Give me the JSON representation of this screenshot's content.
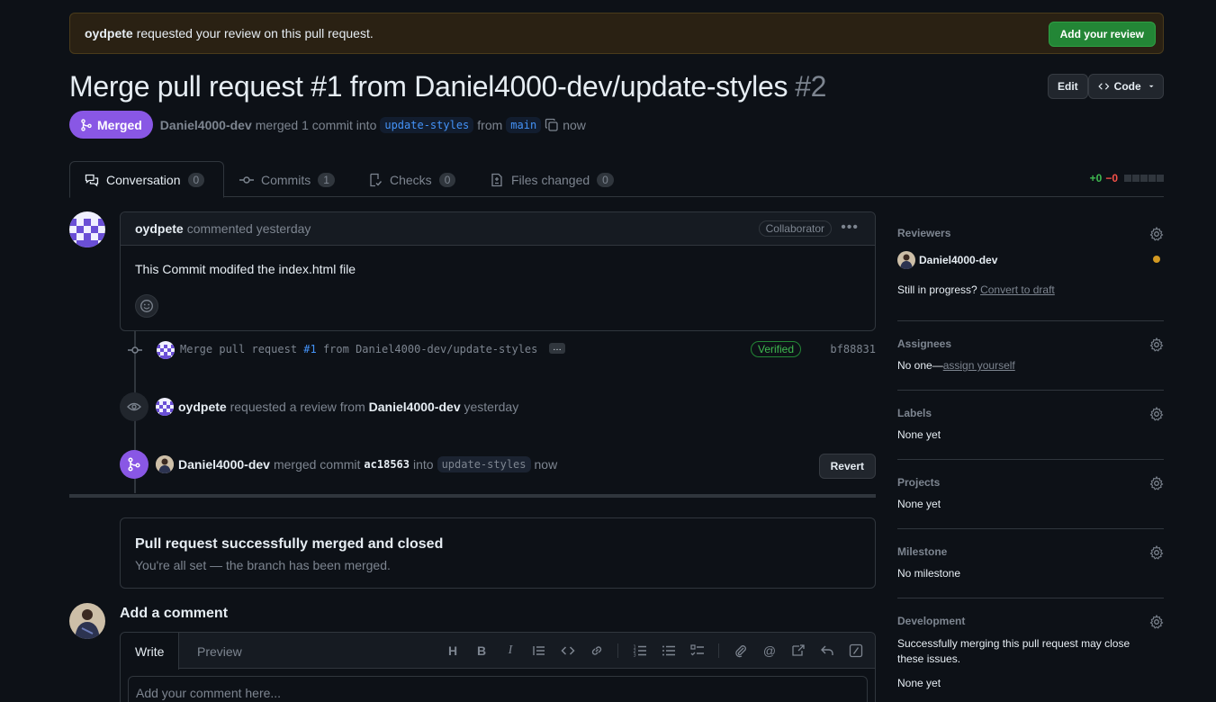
{
  "banner": {
    "user": "oydpete",
    "text": "requested your review on this pull request.",
    "button": "Add your review"
  },
  "pr": {
    "title": "Merge pull request #1 from Daniel4000-dev/update-styles",
    "number": "#2",
    "edit_label": "Edit",
    "code_label": "Code",
    "state": "Merged",
    "author": "Daniel4000-dev",
    "merged_text": "merged 1 commit into",
    "base_branch": "update-styles",
    "from_text": "from",
    "head_branch": "main",
    "time": "now"
  },
  "tabs": [
    {
      "label": "Conversation",
      "count": "0"
    },
    {
      "label": "Commits",
      "count": "1"
    },
    {
      "label": "Checks",
      "count": "0"
    },
    {
      "label": "Files changed",
      "count": "0"
    }
  ],
  "diffstat": {
    "additions": "+0",
    "deletions": "−0"
  },
  "comment": {
    "author": "oydpete",
    "action": "commented yesterday",
    "role": "Collaborator",
    "body": "This Commit modifed the index.html file"
  },
  "timeline": {
    "commit": {
      "msg_prefix": "Merge pull request ",
      "msg_link": "#1",
      "msg_suffix": " from Daniel4000-dev/update-styles",
      "ellipsis": "…",
      "verified": "Verified",
      "sha": "bf88831"
    },
    "review_request": {
      "user": "oydpete",
      "text": "requested a review from",
      "reviewer": "Daniel4000-dev",
      "time": "yesterday"
    },
    "merge": {
      "user": "Daniel4000-dev",
      "text": "merged commit",
      "sha": "ac18563",
      "into": "into",
      "branch": "update-styles",
      "time": "now",
      "revert": "Revert"
    }
  },
  "merged_box": {
    "heading": "Pull request successfully merged and closed",
    "sub": "You're all set — the branch has been merged."
  },
  "add_comment": {
    "title": "Add a comment",
    "write_tab": "Write",
    "preview_tab": "Preview",
    "placeholder": "Add your comment here..."
  },
  "sidebar": {
    "reviewers": {
      "label": "Reviewers",
      "name": "Daniel4000-dev",
      "progress": "Still in progress?",
      "draft_link": "Convert to draft",
      "status_color": "#d29922"
    },
    "assignees": {
      "label": "Assignees",
      "none": "No one—",
      "link": "assign yourself"
    },
    "labels": {
      "label": "Labels",
      "value": "None yet"
    },
    "projects": {
      "label": "Projects",
      "value": "None yet"
    },
    "milestone": {
      "label": "Milestone",
      "value": "No milestone"
    },
    "development": {
      "label": "Development",
      "text": "Successfully merging this pull request may close these issues.",
      "value": "None yet"
    }
  },
  "colors": {
    "bg": "#0d1117",
    "merged": "#8957e5",
    "green": "#238636",
    "link": "#4493f8"
  }
}
